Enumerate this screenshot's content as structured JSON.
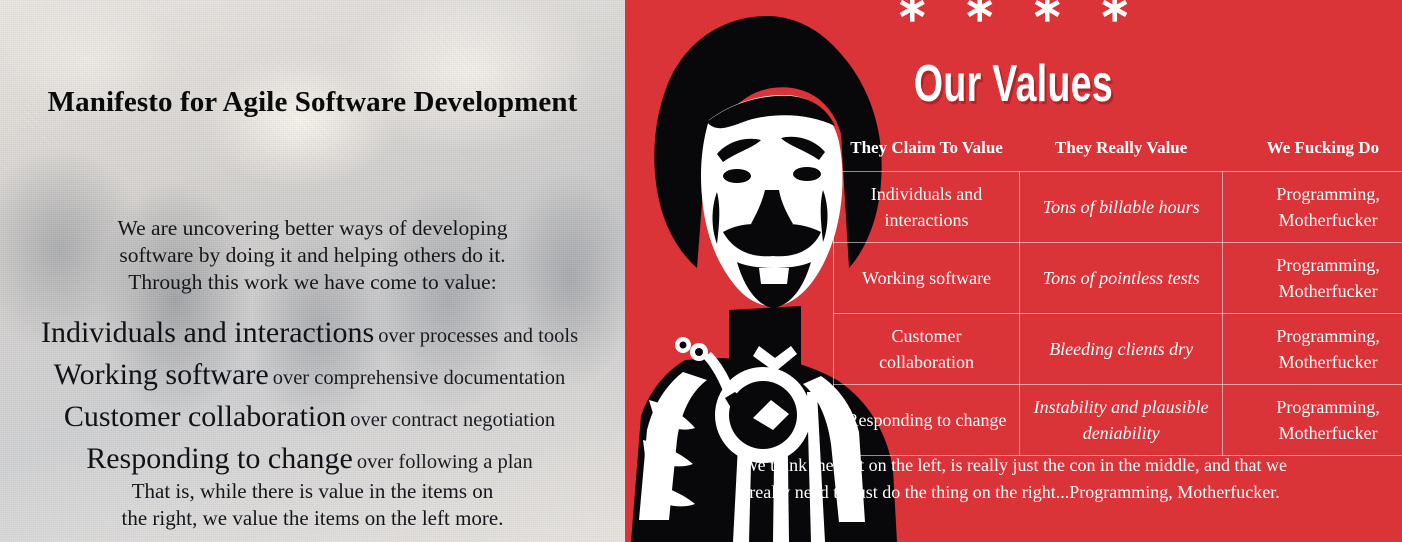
{
  "left": {
    "title": "Manifesto for Agile Software Development",
    "intro": [
      "We are uncovering better ways of developing",
      "software by doing it and helping others do it.",
      "Through this work we have come to value:"
    ],
    "values": [
      {
        "strong": "Individuals and interactions",
        "weak": "over processes and tools"
      },
      {
        "strong": "Working software",
        "weak": "over comprehensive documentation"
      },
      {
        "strong": "Customer collaboration",
        "weak": "over contract negotiation"
      },
      {
        "strong": "Responding to change",
        "weak": "over following a plan"
      }
    ],
    "closing": [
      "That is, while there is value in the items on",
      "the right, we value the items on the left more."
    ]
  },
  "right": {
    "stars": "∗ ∗ ∗ ∗",
    "heading": "Our Values",
    "figure_alt": "stylized-afro-portrait-silhouette",
    "table": {
      "headers": [
        "They Claim To Value",
        "They Really Value",
        "We Fucking Do"
      ],
      "rows": [
        [
          "Individuals and interactions",
          "Tons of billable hours",
          "Programming, Motherfucker"
        ],
        [
          "Working software",
          "Tons of pointless tests",
          "Programming, Motherfucker"
        ],
        [
          "Customer collaboration",
          "Bleeding clients dry",
          "Programming, Motherfucker"
        ],
        [
          "Responding to change",
          "Instability and plausible deniability",
          "Programming, Motherfucker"
        ]
      ]
    },
    "footer": [
      "We think the shit on the left, is really just the con in the middle, and that we",
      "really need to just do the thing on the right...Programming, Motherfucker."
    ]
  },
  "colors": {
    "accent_red": "#da3338",
    "text_light": "#ffffff",
    "text_dark": "#0a0a0a",
    "table_border": "rgba(255,255,255,0.55)"
  }
}
